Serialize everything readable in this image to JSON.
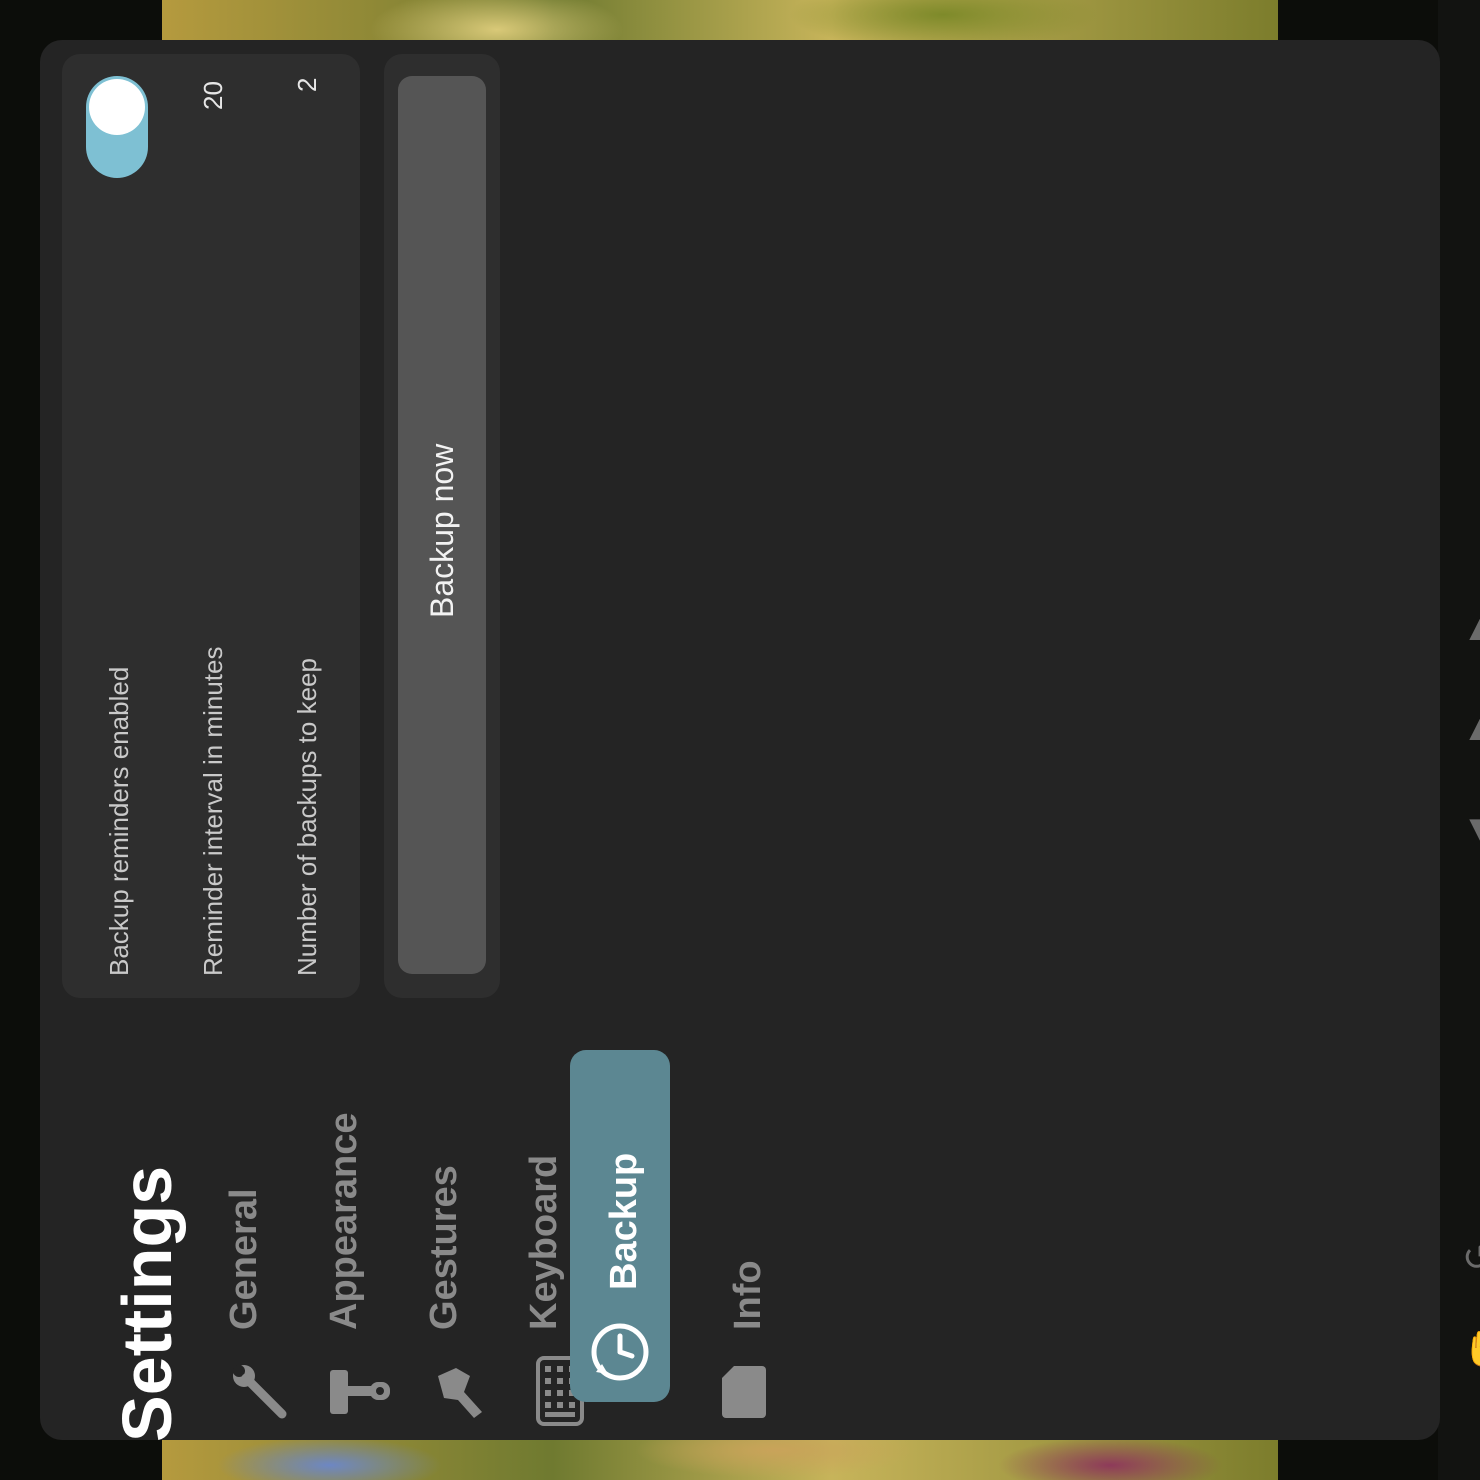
{
  "settings": {
    "title": "Settings",
    "nav": [
      {
        "label": "General",
        "icon": "wrench-icon",
        "selected": false
      },
      {
        "label": "Appearance",
        "icon": "paint-roller-icon",
        "selected": false
      },
      {
        "label": "Gestures",
        "icon": "hand-pointer-icon",
        "selected": false
      },
      {
        "label": "Keyboard",
        "icon": "keyboard-icon",
        "selected": false
      },
      {
        "label": "Backup",
        "icon": "backup-clock-icon",
        "selected": true
      },
      {
        "label": "Info",
        "icon": "document-icon",
        "selected": false
      }
    ],
    "backup": {
      "reminders_label": "Backup reminders enabled",
      "reminders_enabled": true,
      "interval_label": "Reminder interval in minutes",
      "interval_value": "20",
      "keep_label": "Number of backups to keep",
      "keep_value": "2",
      "backup_now_label": "Backup now"
    }
  },
  "colors": {
    "panel": "#242424",
    "card": "#2e2e2e",
    "accent": "#5c8792",
    "toggle_on": "#7ec0d3"
  }
}
